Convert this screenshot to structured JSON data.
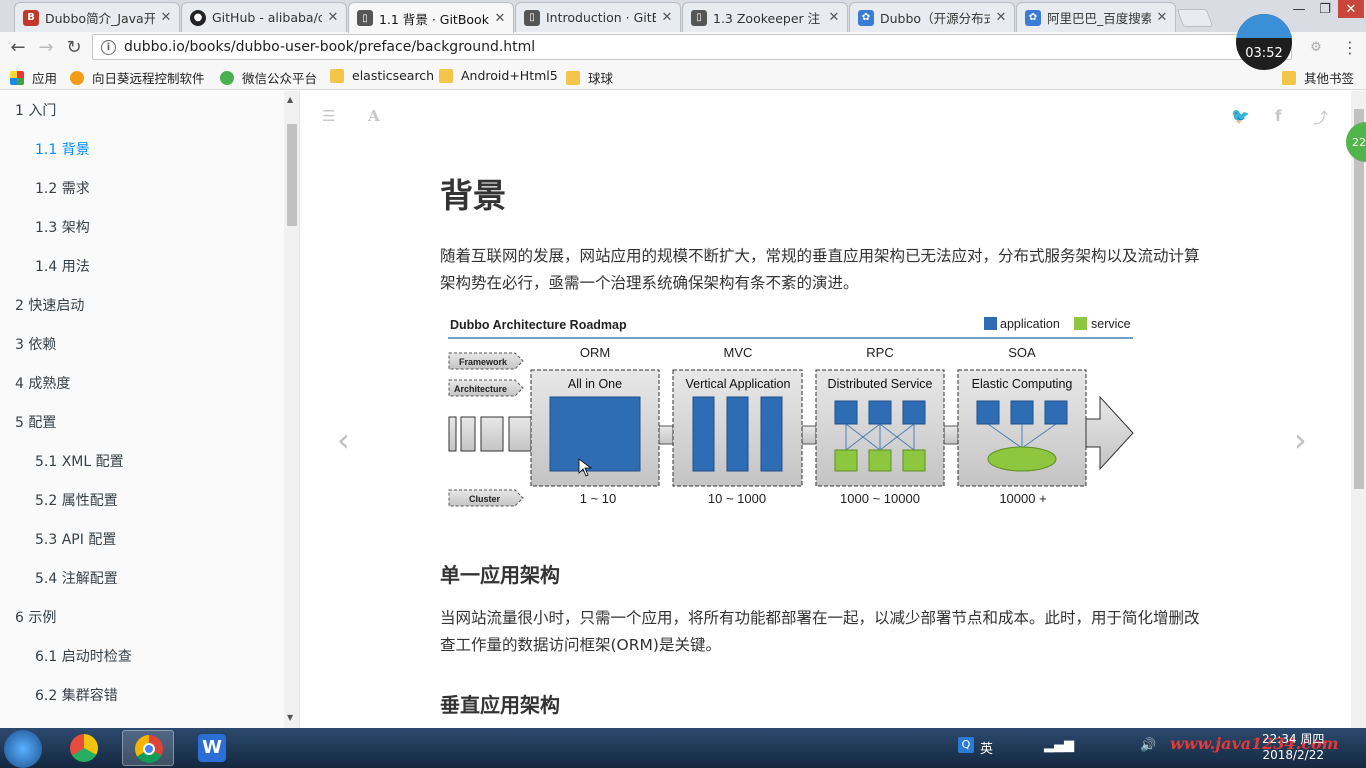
{
  "browser": {
    "tabs": [
      {
        "title": "Dubbo简介_Java开",
        "favicon": "B",
        "color": "#c0392b"
      },
      {
        "title": "GitHub - alibaba/c",
        "favicon": "●",
        "color": "#222222"
      },
      {
        "title": "1.1 背景 · GitBook",
        "favicon": "▯",
        "color": "#444444"
      },
      {
        "title": "Introduction · GitB",
        "favicon": "▯",
        "color": "#444444"
      },
      {
        "title": "1.3 Zookeeper 注",
        "favicon": "▯",
        "color": "#444444"
      },
      {
        "title": "Dubbo（开源分布式",
        "favicon": "✿",
        "color": "#3a7bd5"
      },
      {
        "title": "阿里巴巴_百度搜索",
        "favicon": "✿",
        "color": "#3a7bd5"
      }
    ],
    "tab_close": "✕",
    "url": "dubbo.io/books/dubbo-user-book/preface/background.html",
    "timer": "03:52",
    "bookmarks": [
      {
        "label": "应用",
        "icon": "apps-icon"
      },
      {
        "label": "向日葵远程控制软件",
        "icon": "sunflower-icon"
      },
      {
        "label": "微信公众平台",
        "icon": "wechat-icon"
      },
      {
        "label": "elasticsearch",
        "icon": "folder-icon"
      },
      {
        "label": "Android+Html5",
        "icon": "folder-icon"
      },
      {
        "label": "球球",
        "icon": "folder-icon"
      },
      {
        "label": "其他书签",
        "icon": "folder-icon"
      }
    ]
  },
  "sidebar": {
    "items": [
      {
        "label": "1 入门",
        "level": 0,
        "active": false
      },
      {
        "label": "1.1 背景",
        "level": 1,
        "active": true
      },
      {
        "label": "1.2 需求",
        "level": 1,
        "active": false
      },
      {
        "label": "1.3 架构",
        "level": 1,
        "active": false
      },
      {
        "label": "1.4 用法",
        "level": 1,
        "active": false
      },
      {
        "label": "2 快速启动",
        "level": 0,
        "active": false
      },
      {
        "label": "3 依赖",
        "level": 0,
        "active": false
      },
      {
        "label": "4 成熟度",
        "level": 0,
        "active": false
      },
      {
        "label": "5 配置",
        "level": 0,
        "active": false
      },
      {
        "label": "5.1 XML 配置",
        "level": 1,
        "active": false
      },
      {
        "label": "5.2 属性配置",
        "level": 1,
        "active": false
      },
      {
        "label": "5.3 API 配置",
        "level": 1,
        "active": false
      },
      {
        "label": "5.4 注解配置",
        "level": 1,
        "active": false
      },
      {
        "label": "6 示例",
        "level": 0,
        "active": false
      },
      {
        "label": "6.1 启动时检查",
        "level": 1,
        "active": false
      },
      {
        "label": "6.2 集群容错",
        "level": 1,
        "active": false
      }
    ]
  },
  "content": {
    "title": "背景",
    "intro": "随着互联网的发展，网站应用的规模不断扩大，常规的垂直应用架构已无法应对，分布式服务架构以及流动计算架构势在必行，亟需一个治理系统确保架构有条不紊的演进。",
    "h2_single": "单一应用架构",
    "single_text": "当网站流量很小时，只需一个应用，将所有功能都部署在一起，以减少部署节点和成本。此时，用于简化增删改查工作量的数据访问框架(ORM)是关键。",
    "h2_vertical": "垂直应用架构"
  },
  "diagram": {
    "title": "Dubbo Architecture Roadmap",
    "legend_application": "application",
    "legend_service": "service",
    "row_labels": [
      "Framework",
      "Architecture",
      "Cluster"
    ],
    "stages": [
      {
        "framework": "ORM",
        "architecture": "All in One",
        "cluster": "1 ~ 10"
      },
      {
        "framework": "MVC",
        "architecture": "Vertical Application",
        "cluster": "10 ~ 1000"
      },
      {
        "framework": "RPC",
        "architecture": "Distributed Service",
        "cluster": "1000 ~ 10000"
      },
      {
        "framework": "SOA",
        "architecture": "Elastic Computing",
        "cluster": "10000 +"
      }
    ],
    "colors": {
      "application": "#2e6db4",
      "service": "#8dc63f",
      "line": "#4a7fb5"
    }
  },
  "taskbar": {
    "ime": "英",
    "clock_time": "22:34 周四",
    "clock_date": "2018/2/22",
    "watermark": "www.java1234.com"
  },
  "badge": "22"
}
